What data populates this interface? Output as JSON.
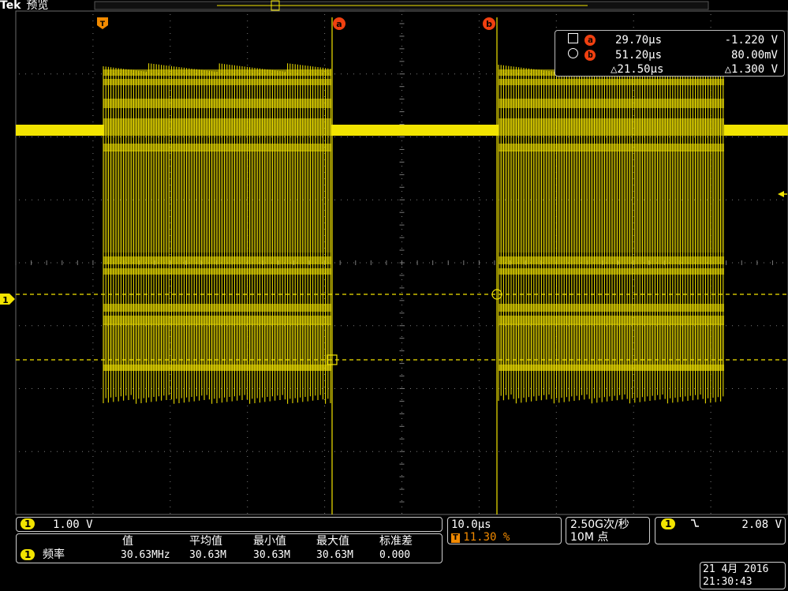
{
  "header": {
    "brand": "Tek",
    "mode": "预览",
    "trigger_marker_label": "T",
    "cursor_a_label": "a",
    "cursor_b_label": "b"
  },
  "channel_marker": "1",
  "colors": {
    "trace": "#f2e400",
    "cursor_badge": "#f04010",
    "grid": "#7a7a7a",
    "panel_border": "#cfcfcf"
  },
  "cursor_readout": {
    "a": {
      "label": "a",
      "time": "29.70µs",
      "volt": "-1.220 V"
    },
    "b": {
      "label": "b",
      "time": "51.20µs",
      "volt": "80.00mV"
    },
    "delta": {
      "time": "△21.50µs",
      "volt": "△1.300 V"
    }
  },
  "bottom": {
    "ch1": {
      "badge": "1",
      "scale": "1.00 V"
    },
    "measure": {
      "badge": "1",
      "name": "频率",
      "headers": [
        "值",
        "平均值",
        "最小值",
        "最大值",
        "标准差"
      ],
      "values": [
        "30.63MHz",
        "30.63M",
        "30.63M",
        "30.63M",
        "0.000"
      ]
    },
    "timebase": {
      "scale": "10.0µs",
      "trig_badge": "T",
      "position": "11.30 %"
    },
    "acquisition": {
      "rate": "2.50G次/秒",
      "length": "10M 点"
    },
    "trigger": {
      "badge": "1",
      "slope_icon": "falling-edge-icon",
      "level": "2.08 V"
    },
    "datetime": {
      "date": "21 4月 2016",
      "time": "21:30:43"
    }
  }
}
